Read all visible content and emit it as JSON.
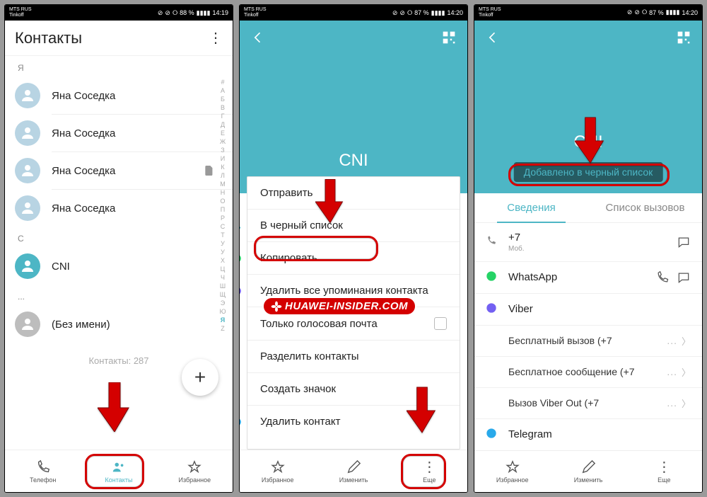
{
  "statusbar": {
    "left_line1": "MTS RUS",
    "left_line2": "Tinkoff",
    "battery1": "88 %",
    "battery2": "87 %",
    "battery3": "87 %",
    "time1": "14:19",
    "time2": "14:20",
    "time3": "14:20"
  },
  "s1": {
    "title": "Контакты",
    "sections": {
      "ya": "Я",
      "c": "C",
      "dots": "..."
    },
    "contacts": {
      "yana": "Яна Соседка",
      "cni": "CNI",
      "noname": "(Без имени)"
    },
    "count": "Контакты: 287",
    "nav": {
      "phone": "Телефон",
      "contacts": "Контакты",
      "fav": "Избранное"
    },
    "alpha": [
      "#",
      "А",
      "Б",
      "В",
      "Г",
      "Д",
      "Е",
      "Ж",
      "З",
      "И",
      "К",
      "Л",
      "М",
      "Н",
      "О",
      "П",
      "Р",
      "С",
      "Т",
      "У",
      "У",
      "Х",
      "Ц",
      "Ч",
      "Ш",
      "Щ",
      "Э",
      "Ю",
      "Я",
      "Z"
    ]
  },
  "s2": {
    "contact_name": "CNI",
    "menu": {
      "send": "Отправить",
      "blacklist": "В черный список",
      "copy": "Копировать",
      "delete_mentions": "Удалить все упоминания контакта",
      "voicemail_only": "Только голосовая почта",
      "split": "Разделить контакты",
      "shortcut": "Создать значок",
      "delete": "Удалить контакт"
    },
    "nav": {
      "fav": "Избранное",
      "edit": "Изменить",
      "more": "Еще"
    }
  },
  "s3": {
    "contact_name": "CNI",
    "banner": "Добавлено в черный список",
    "tabs": {
      "info": "Сведения",
      "calls": "Список вызовов"
    },
    "rows": {
      "phone": "+7",
      "phone_sub": "Моб.",
      "whatsapp": "WhatsApp",
      "viber": "Viber",
      "free_call": "Бесплатный вызов (+7",
      "free_msg": "Бесплатное сообщение (+7",
      "viber_out": "Вызов Viber Out (+7",
      "telegram": "Telegram"
    }
  },
  "watermark": "HUAWEI-INSIDER.COM"
}
